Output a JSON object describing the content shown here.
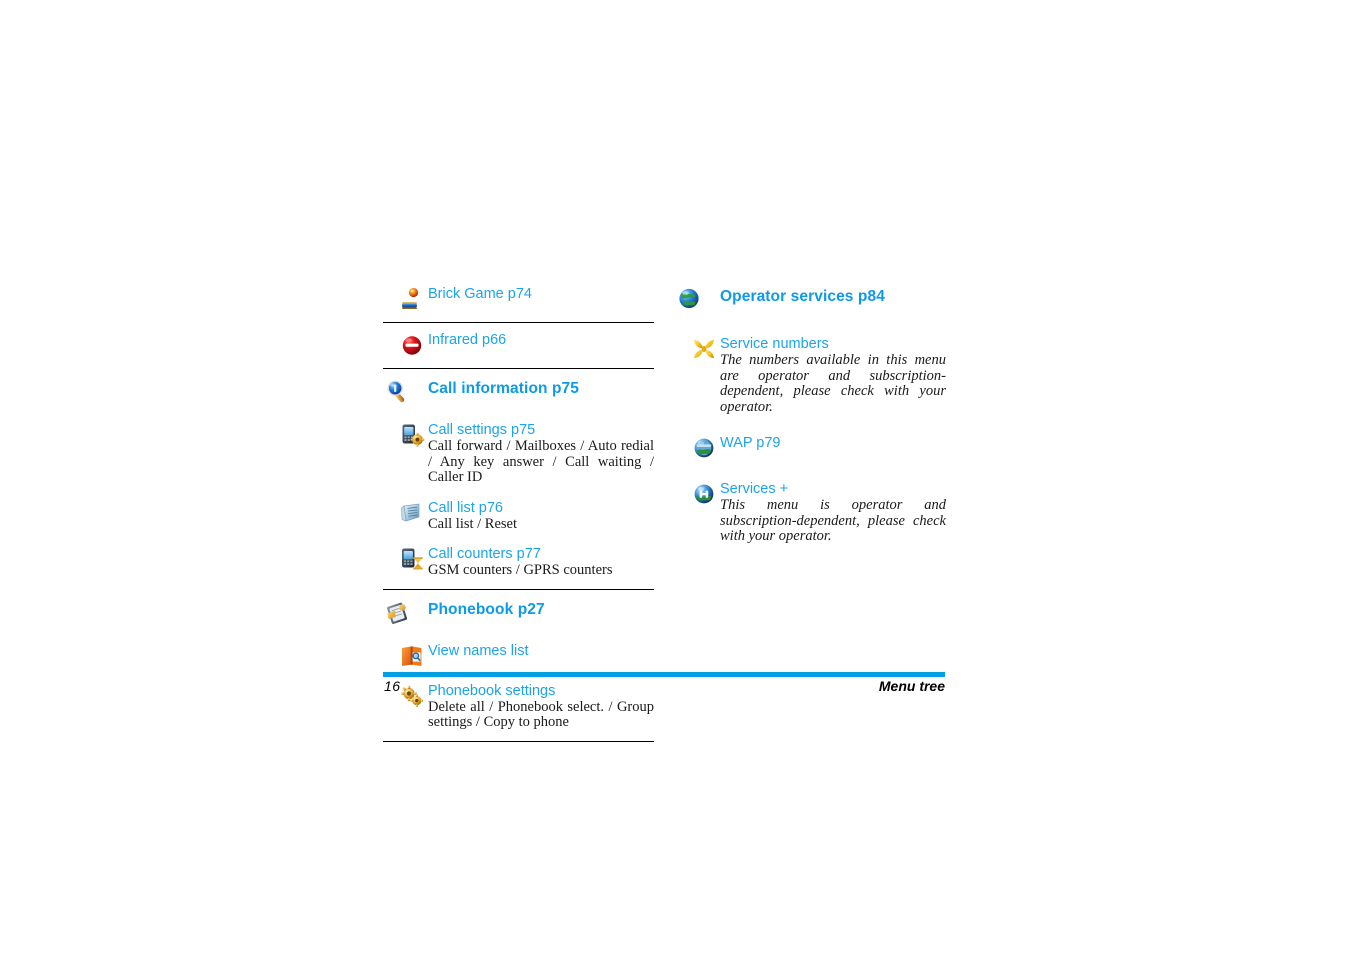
{
  "document": {
    "footer": {
      "page_number": "16",
      "section_label": "Menu tree",
      "bar_color": "#029fe3"
    },
    "colors": {
      "heading_blue": "#0d9ae8",
      "item_blue": "#1ba4ea",
      "rule_black": "#000000",
      "body_text": "#1a1a1a"
    }
  },
  "left_column": {
    "entries": [
      {
        "level": 1,
        "icon": "brick-game-icon",
        "title": "Brick Game p74",
        "description": ""
      },
      {
        "level": 1,
        "icon": "infrared-icon",
        "title": "Infrared p66",
        "description": ""
      },
      {
        "level": 1,
        "icon": "magnifier-icon",
        "title": "Call information p75",
        "description": ""
      },
      {
        "level": 2,
        "icon": "call-settings-icon",
        "title": "Call settings p75",
        "description": "Call forward / Mailboxes / Auto redial / Any key answer / Call waiting / Caller ID"
      },
      {
        "level": 2,
        "icon": "call-list-icon",
        "title": "Call list p76",
        "description": "Call list / Reset"
      },
      {
        "level": 2,
        "icon": "call-counters-icon",
        "title": "Call counters p77",
        "description": "GSM counters / GPRS counters"
      },
      {
        "level": 1,
        "icon": "phonebook-icon",
        "title": "Phonebook p27",
        "description": ""
      },
      {
        "level": 2,
        "icon": "view-names-icon",
        "title": "View names list",
        "description": ""
      },
      {
        "level": 2,
        "icon": "phonebook-settings-icon",
        "title": "Phonebook settings",
        "description": "Delete all / Phonebook select. / Group settings / Copy to phone"
      }
    ]
  },
  "right_column": {
    "entries": [
      {
        "level": 1,
        "icon": "globe-icon",
        "title": "Operator services p84",
        "description": ""
      },
      {
        "level": 2,
        "icon": "service-numbers-icon",
        "title": "Service numbers",
        "description": "The numbers available in this menu are operator and subscription-dependent, please check with your operator."
      },
      {
        "level": 2,
        "icon": "wap-globe-icon",
        "title": "WAP p79",
        "description": ""
      },
      {
        "level": 2,
        "icon": "services-plus-icon",
        "title": "Services +",
        "description": "This menu is operator and subscription-dependent, please check with your operator."
      }
    ]
  }
}
